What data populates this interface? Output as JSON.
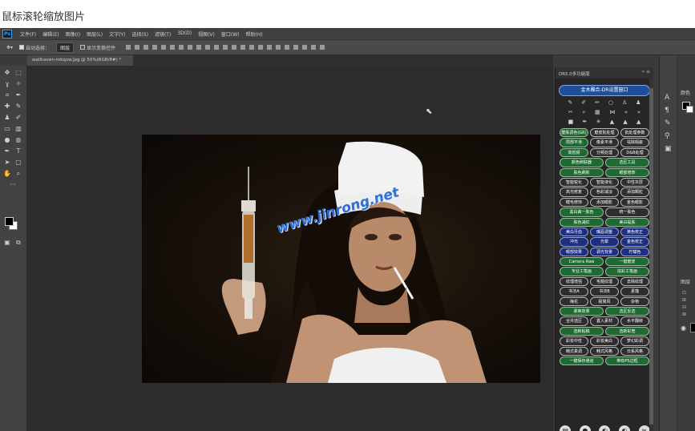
{
  "caption": "鼠标滚轮缩放图片",
  "app": {
    "logo": "Ps",
    "menus": [
      "文件(F)",
      "编辑(E)",
      "图像(I)",
      "图层(L)",
      "文字(Y)",
      "选择(S)",
      "滤镜(T)",
      "3D(D)",
      "视图(V)",
      "窗口(W)",
      "帮助(H)"
    ]
  },
  "options_bar": {
    "auto_select_label": "自动选择：",
    "auto_select_value": "图层",
    "show_transform_label": "显示变换控件"
  },
  "document": {
    "tab_label": "wallhaven-mkqxw.jpg @ 50%(RGB/8#) *"
  },
  "photo": {
    "watermark": "www.jinrong.net"
  },
  "dr_panel": {
    "title": "DR5.0多功能版",
    "title_controls": "«  ≡",
    "main_button": "金木雕合-DR设置窗口",
    "icon_rows": [
      [
        "wand-icon",
        "brush-icon",
        "pencil-icon",
        "circle-icon",
        "user-icon",
        "users-icon"
      ],
      [
        "bandage-icon",
        "search-icon",
        "grid-icon",
        "ruler-icon",
        "chevron-left-icon",
        "chevron-right-icon"
      ],
      [
        "square-icon",
        "pen-icon",
        "sparkle-icon",
        "stack-icon",
        "stack-icon",
        "stack-icon"
      ]
    ],
    "icon_glyphs": {
      "wand-icon": "✎",
      "brush-icon": "✐",
      "pencil-icon": "✏",
      "circle-icon": "○",
      "user-icon": "♙",
      "users-icon": "♟",
      "bandage-icon": "✂",
      "search-icon": "⌕",
      "grid-icon": "▦",
      "ruler-icon": "⋈",
      "chevron-left-icon": "«",
      "chevron-right-icon": "»",
      "square-icon": "■",
      "pen-icon": "✒",
      "sparkle-icon": "✳",
      "stack-icon": "▲"
    },
    "buttons": [
      [
        {
          "label": "磨肤调色(GR)",
          "color": "green"
        },
        {
          "label": "磨皮批处理",
          "color": "gray"
        },
        {
          "label": "批处理参数",
          "color": "gray"
        }
      ],
      [
        {
          "label": "局部平滑",
          "color": "green"
        },
        {
          "label": "像素平滑",
          "color": "gray"
        },
        {
          "label": "祛除瑕疵",
          "color": "gray"
        }
      ],
      [
        {
          "label": "高低频",
          "color": "green"
        },
        {
          "label": "分频处理",
          "color": "gray"
        },
        {
          "label": "D&B处理",
          "color": "gray"
        }
      ],
      [
        {
          "label": "颜色刷肤器",
          "color": "green"
        },
        {
          "label": "选区工具",
          "color": "green"
        }
      ],
      [
        {
          "label": "肤色刷新",
          "color": "green"
        },
        {
          "label": "眼部修饰",
          "color": "green"
        }
      ],
      [
        {
          "label": "智能锐化",
          "color": "gray"
        },
        {
          "label": "智能液化",
          "color": "gray"
        },
        {
          "label": "中性灰层",
          "color": "gray"
        }
      ],
      [
        {
          "label": "高光修复",
          "color": "gray"
        },
        {
          "label": "色彩减淡",
          "color": "gray"
        },
        {
          "label": "添加颗粒",
          "color": "gray"
        }
      ],
      [
        {
          "label": "睫毛修饰",
          "color": "gray"
        },
        {
          "label": "添加眼影",
          "color": "gray"
        },
        {
          "label": "金色眼影",
          "color": "gray"
        }
      ],
      [
        {
          "label": "黑白曲一肤色",
          "color": "green"
        },
        {
          "label": "统一肤色",
          "color": "gray"
        }
      ],
      [
        {
          "label": "肤色减红",
          "color": "green"
        },
        {
          "label": "美白提肤",
          "color": "green"
        }
      ],
      [
        {
          "label": "美白牙齿",
          "color": "blue"
        },
        {
          "label": "嘴唇调整",
          "color": "blue"
        },
        {
          "label": "黄色校正",
          "color": "blue"
        }
      ],
      [
        {
          "label": "冲光",
          "color": "blue"
        },
        {
          "label": "光晕",
          "color": "blue"
        },
        {
          "label": "金色校正",
          "color": "blue"
        }
      ],
      [
        {
          "label": "眼部效果",
          "color": "blue"
        },
        {
          "label": "调光背景",
          "color": "blue"
        },
        {
          "label": "柠檬色",
          "color": "blue"
        }
      ],
      [
        {
          "label": "Camera Raw",
          "color": "green"
        },
        {
          "label": "一键磨皮",
          "color": "green"
        }
      ],
      [
        {
          "label": "专业工笔画",
          "color": "green"
        },
        {
          "label": "炫彩工笔画",
          "color": "green"
        }
      ],
      [
        {
          "label": "纹理增强",
          "color": "gray"
        },
        {
          "label": "毛糙纹理",
          "color": "gray"
        },
        {
          "label": "去除纹理",
          "color": "gray"
        }
      ],
      [
        {
          "label": "书法A",
          "color": "gray"
        },
        {
          "label": "书法B",
          "color": "gray"
        },
        {
          "label": "素描",
          "color": "gray"
        }
      ],
      [
        {
          "label": "梅花",
          "color": "gray"
        },
        {
          "label": "极简风",
          "color": "gray"
        },
        {
          "label": "杂物",
          "color": "gray"
        }
      ],
      [
        {
          "label": "柔焦效果",
          "color": "green"
        },
        {
          "label": "选区反选",
          "color": "green"
        }
      ],
      [
        {
          "label": "合并选区",
          "color": "gray"
        },
        {
          "label": "置入素材",
          "color": "gray"
        },
        {
          "label": "水平翻转",
          "color": "gray"
        }
      ],
      [
        {
          "label": "选新粘稿",
          "color": "green"
        },
        {
          "label": "选新彩宽",
          "color": "green"
        }
      ],
      [
        {
          "label": "彩妆中性",
          "color": "gray"
        },
        {
          "label": "彩妆美白",
          "color": "gray"
        },
        {
          "label": "梦幻彩调",
          "color": "gray"
        }
      ],
      [
        {
          "label": "韩式柔调",
          "color": "gray"
        },
        {
          "label": "韩式风格",
          "color": "gray"
        },
        {
          "label": "日系风格",
          "color": "gray"
        }
      ],
      [
        {
          "label": "一键保存通道",
          "color": "green"
        },
        {
          "label": "带有PS边框",
          "color": "green"
        }
      ]
    ],
    "bottom_icons": [
      "gradient-icon",
      "circle-filled-icon",
      "half-circle-icon",
      "half-circle-icon",
      "tools-icon"
    ],
    "bottom_glyphs": {
      "gradient-icon": "▤",
      "circle-filled-icon": "●",
      "half-circle-icon": "◐",
      "tools-icon": "✂"
    },
    "colors": {
      "green": "#1f6a33",
      "blue": "#1d2f7e",
      "gray": "#2e2e2e"
    }
  },
  "right_panel": {
    "label_top": "颜色",
    "label_mid": "图层",
    "icons": [
      "text-icon",
      "paragraph-icon",
      "brush-icon",
      "stamp-icon",
      "swatch-icon"
    ],
    "icon_glyphs": {
      "text-icon": "A",
      "paragraph-icon": "¶",
      "brush-icon": "✎",
      "stamp-icon": "⚲",
      "swatch-icon": "▣"
    }
  }
}
